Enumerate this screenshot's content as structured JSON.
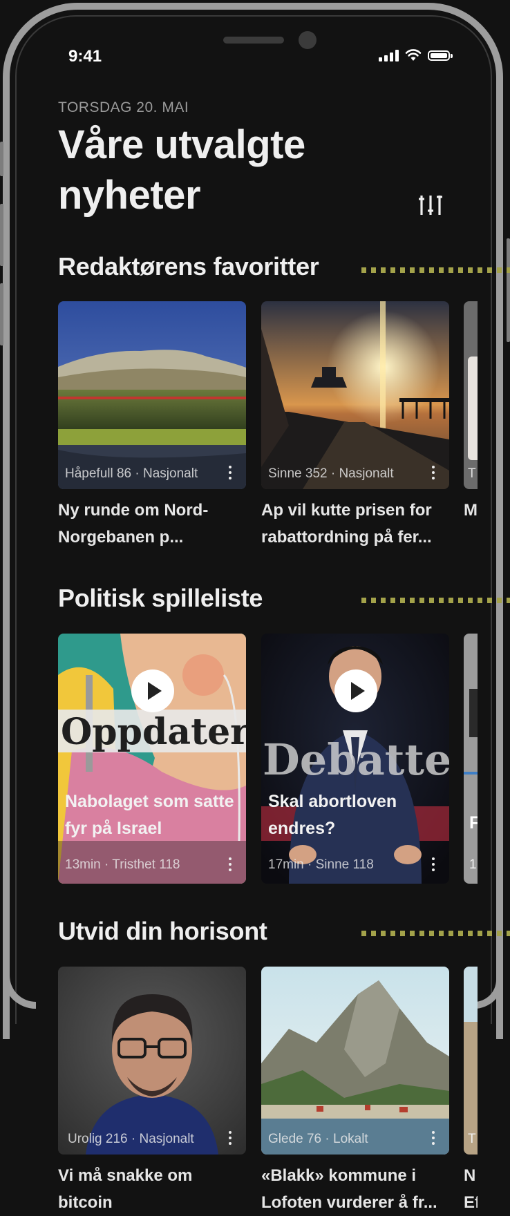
{
  "status": {
    "time": "9:41"
  },
  "header": {
    "date": "TORSDAG 20. MAI",
    "title": "Våre utvalgte nyheter"
  },
  "sections": [
    {
      "title": "Redaktørens favoritter",
      "cards": [
        {
          "meta": "Håpefull 86 · Nasjonalt",
          "caption": "Ny runde om Nord-Norgebanen p..."
        },
        {
          "meta": "Sinne 352 · Nasjonalt",
          "caption": "Ap vil kutte prisen for rabattordning på fer..."
        },
        {
          "meta": "T",
          "caption": "M"
        }
      ]
    },
    {
      "title": "Politisk spilleliste",
      "cards": [
        {
          "overlay": "Oppdatert",
          "title": "Nabolaget som satte fyr på Israel",
          "meta": "13min · Tristhet 118"
        },
        {
          "overlay": "Debatten",
          "title": "Skal abortloven endres?",
          "meta": "17min · Sinne 118"
        },
        {
          "title": "F",
          "meta": "1"
        }
      ]
    },
    {
      "title": "Utvid din horisont",
      "cards": [
        {
          "meta": "Urolig 216 · Nasjonalt",
          "caption": "Vi må snakke om bitcoin"
        },
        {
          "meta": "Glede 76 · Lokalt",
          "caption": "«Blakk» kommune i Lofoten vurderer å fr..."
        },
        {
          "meta": "T",
          "caption": "N Ef"
        }
      ]
    }
  ],
  "icons": {
    "filter": "filter-sliders-icon",
    "play": "play-icon",
    "more": "more-vertical-icon",
    "signal": "cellular-signal-icon",
    "wifi": "wifi-icon",
    "battery": "battery-icon"
  },
  "colors": {
    "background": "#121212",
    "accent_dots": "#a3a24a",
    "text": "#efefef"
  }
}
